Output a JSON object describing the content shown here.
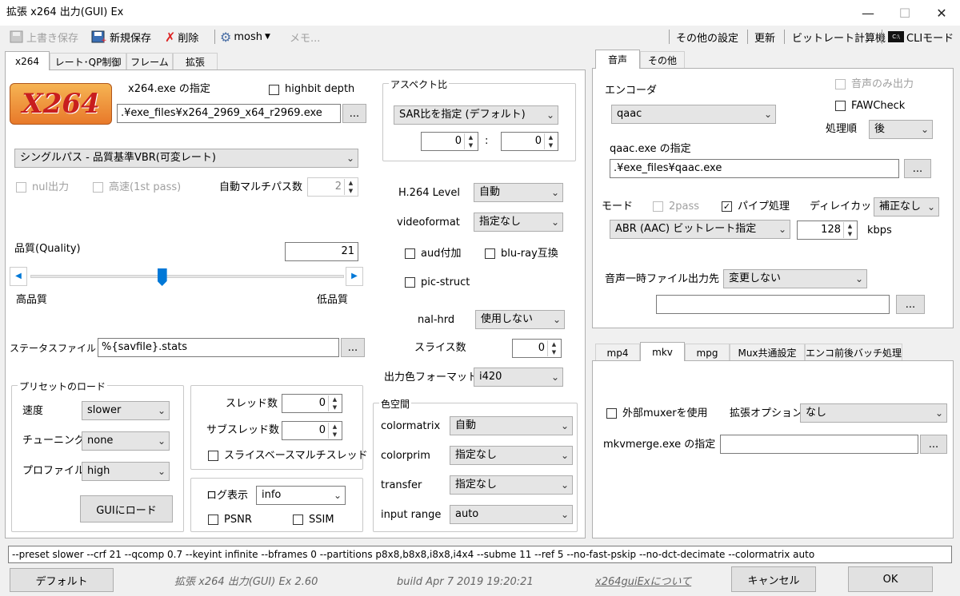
{
  "window": {
    "title": "拡張 x264 出力(GUI) Ex",
    "minimize": "—",
    "maximize": "☐",
    "close": "✕"
  },
  "toolbar": {
    "overwrite_save": "上書き保存",
    "new_save": "新規保存",
    "delete": "削除",
    "preset": "mosh",
    "memo": "メモ...",
    "other_settings": "その他の設定",
    "update": "更新",
    "bitrate_calc": "ビットレート計算機",
    "cli_mode": "CLIモード"
  },
  "left_tabs": [
    "x264",
    "レート･QP制御",
    "フレーム",
    "拡張"
  ],
  "x264": {
    "logo_text": "X264",
    "exe_label": "x264.exe の指定",
    "highbit_label": "highbit depth",
    "exe_path": ".¥exe_files¥x264_2969_x64_r2969.exe",
    "browse": "...",
    "mode_select": "シングルパス - 品質基準VBR(可変レート)",
    "nul_output": "nul出力",
    "fast_first_pass": "高速(1st pass)",
    "auto_multipass": "自動マルチパス数",
    "auto_multipass_value": "2",
    "quality_label": "品質(Quality)",
    "quality_value": "21",
    "quality_level": 0.42,
    "high_quality": "高品質",
    "low_quality": "低品質",
    "stats_label": "ステータスファイル",
    "stats_value": "%{savfile}.stats",
    "preset_group": "プリセットのロード",
    "speed_label": "速度",
    "speed_value": "slower",
    "tuning_label": "チューニング",
    "tuning_value": "none",
    "profile_label": "プロファイル",
    "profile_value": "high",
    "gui_load": "GUIにロード",
    "threads_label": "スレッド数",
    "threads_value": "0",
    "subthreads_label": "サブスレッド数",
    "subthreads_value": "0",
    "slice_multithread": "スライスベースマルチスレッド",
    "log_label": "ログ表示",
    "log_value": "info",
    "psnr": "PSNR",
    "ssim": "SSIM",
    "aspect_group": "アスペクト比",
    "aspect_select": "SAR比を指定 (デフォルト)",
    "aspect_w": "0",
    "aspect_h": "0",
    "aspect_colon": ":",
    "h264_level_label": "H.264 Level",
    "h264_level_value": "自動",
    "videoformat_label": "videoformat",
    "videoformat_value": "指定なし",
    "aud": "aud付加",
    "bluray": "blu-ray互換",
    "pic_struct": "pic-struct",
    "nal_hrd_label": "nal-hrd",
    "nal_hrd_value": "使用しない",
    "slices_label": "スライス数",
    "slices_value": "0",
    "output_color_label": "出力色フォーマット",
    "output_color_value": "i420",
    "colorspace_group": "色空間",
    "colormatrix_label": "colormatrix",
    "colormatrix_value": "自動",
    "colorprim_label": "colorprim",
    "colorprim_value": "指定なし",
    "transfer_label": "transfer",
    "transfer_value": "指定なし",
    "input_range_label": "input range",
    "input_range_value": "auto"
  },
  "audio_tabs": [
    "音声",
    "その他"
  ],
  "audio": {
    "encoder_label": "エンコーダ",
    "encoder_value": "qaac",
    "audio_only": "音声のみ出力",
    "faw_check": "FAWCheck",
    "order_label": "処理順",
    "order_value": "後",
    "exe_label": "qaac.exe の指定",
    "exe_path": ".¥exe_files¥qaac.exe",
    "mode_label": "モード",
    "twopass": "2pass",
    "pipe": "パイプ処理",
    "delay_cut_label": "ディレイカット",
    "delay_cut_value": "補正なし",
    "mode_value": "ABR (AAC) ビットレート指定",
    "bitrate_value": "128",
    "kbps": "kbps",
    "temp_dir_label": "音声一時ファイル出力先",
    "temp_dir_value": "変更しない",
    "temp_dir_path": ""
  },
  "mux_tabs": [
    "mp4",
    "mkv",
    "mpg",
    "Mux共通設定",
    "エンコ前後バッチ処理"
  ],
  "mux": {
    "external_muxer": "外部muxerを使用",
    "ext_option_label": "拡張オプション",
    "ext_option_value": "なし",
    "mkvmerge_label": "mkvmerge.exe の指定",
    "mkvmerge_path": ""
  },
  "cmdline": "--preset slower --crf 21 --qcomp 0.7 --keyint infinite --bframes 0 --partitions p8x8,b8x8,i8x8,i4x4 --subme 11 --ref 5 --no-fast-pskip --no-dct-decimate --colormatrix auto",
  "footer": {
    "default": "デフォルト",
    "version": "拡張 x264 出力(GUI) Ex 2.60",
    "build": "build Apr  7 2019 19:20:21",
    "about": "x264guiExについて",
    "cancel": "キャンセル",
    "ok": "OK"
  },
  "colors": {
    "accent": "#0078d7",
    "logo_red": "#c81e1e",
    "logo_orange": "#f29a2e"
  }
}
